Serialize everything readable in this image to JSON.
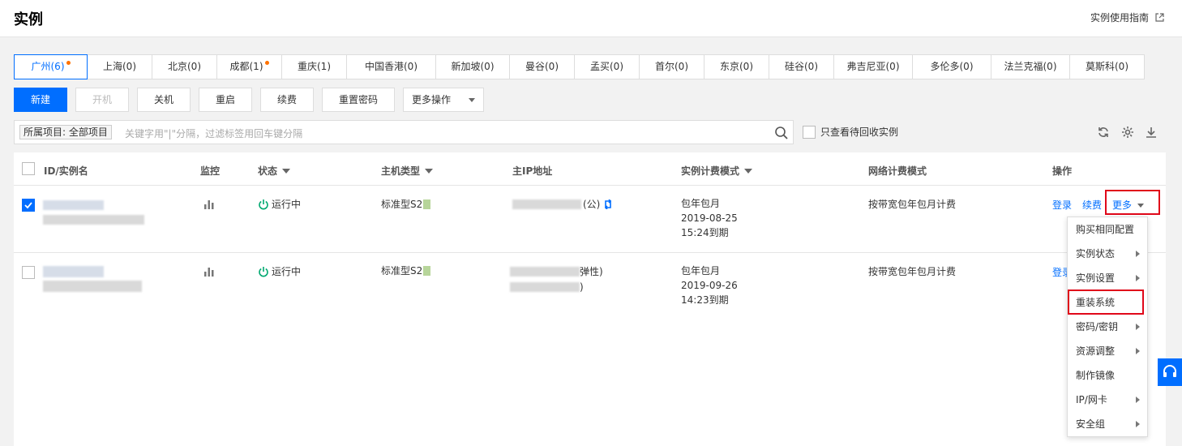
{
  "header": {
    "title": "实例",
    "guide": "实例使用指南"
  },
  "regions": [
    {
      "label": "广州(6)",
      "dot": true,
      "active": true,
      "w": 91
    },
    {
      "label": "上海(0)",
      "dot": false,
      "w": 80
    },
    {
      "label": "北京(0)",
      "dot": false,
      "w": 80
    },
    {
      "label": "成都(1)",
      "dot": true,
      "w": 80
    },
    {
      "label": "重庆(1)",
      "dot": false,
      "w": 80
    },
    {
      "label": "中国香港(0)",
      "dot": false,
      "w": 110
    },
    {
      "label": "新加坡(0)",
      "dot": false,
      "w": 91
    },
    {
      "label": "曼谷(0)",
      "dot": false,
      "w": 80
    },
    {
      "label": "孟买(0)",
      "dot": false,
      "w": 80
    },
    {
      "label": "首尔(0)",
      "dot": false,
      "w": 80
    },
    {
      "label": "东京(0)",
      "dot": false,
      "w": 80
    },
    {
      "label": "硅谷(0)",
      "dot": false,
      "w": 80
    },
    {
      "label": "弗吉尼亚(0)",
      "dot": false,
      "w": 97
    },
    {
      "label": "多伦多(0)",
      "dot": false,
      "w": 97
    },
    {
      "label": "法兰克福(0)",
      "dot": false,
      "w": 97
    },
    {
      "label": "莫斯科(0)",
      "dot": false,
      "w": 91
    }
  ],
  "toolbar": {
    "new": "新建",
    "start": "开机",
    "shutdown": "关机",
    "restart": "重启",
    "renew": "续费",
    "reset_password": "重置密码",
    "more_actions": "更多操作"
  },
  "search": {
    "tag": "所属项目: 全部项目",
    "placeholder": "关键字用\"|\"分隔，过滤标签用回车键分隔",
    "recycle_label": "只查看待回收实例"
  },
  "table": {
    "headers": {
      "id": "ID/实例名",
      "monitor": "监控",
      "status": "状态",
      "host_type": "主机类型",
      "ip": "主IP地址",
      "billing": "实例计费模式",
      "network_billing": "网络计费模式",
      "ops": "操作"
    },
    "rows": [
      {
        "status": "运行中",
        "host_type": "标准型S2",
        "ip_suffix": "(公)",
        "billing_mode": "包年包月",
        "billing_date": "2019-08-25",
        "billing_expire": "15:24到期",
        "network_billing": "按带宽包年包月计费",
        "login": "登录",
        "renew": "续费",
        "more": "更多"
      },
      {
        "status": "运行中",
        "host_type": "标准型S2",
        "ip_suffix": "弹性)",
        "ip_suffix2": ")",
        "billing_mode": "包年包月",
        "billing_date": "2019-09-26",
        "billing_expire": "14:23到期",
        "network_billing": "按带宽包年包月计费",
        "login": "登录"
      }
    ]
  },
  "more_menu": [
    {
      "label": "购买相同配置",
      "arrow": false
    },
    {
      "label": "实例状态",
      "arrow": true
    },
    {
      "label": "实例设置",
      "arrow": true
    },
    {
      "label": "重装系统",
      "arrow": false
    },
    {
      "label": "密码/密钥",
      "arrow": true
    },
    {
      "label": "资源调整",
      "arrow": true
    },
    {
      "label": "制作镜像",
      "arrow": false
    },
    {
      "label": "IP/网卡",
      "arrow": true
    },
    {
      "label": "安全组",
      "arrow": true
    }
  ],
  "colors": {
    "primary": "#006eff",
    "highlight": "#e0081a",
    "running": "#00a870",
    "dot": "#ff7200"
  }
}
